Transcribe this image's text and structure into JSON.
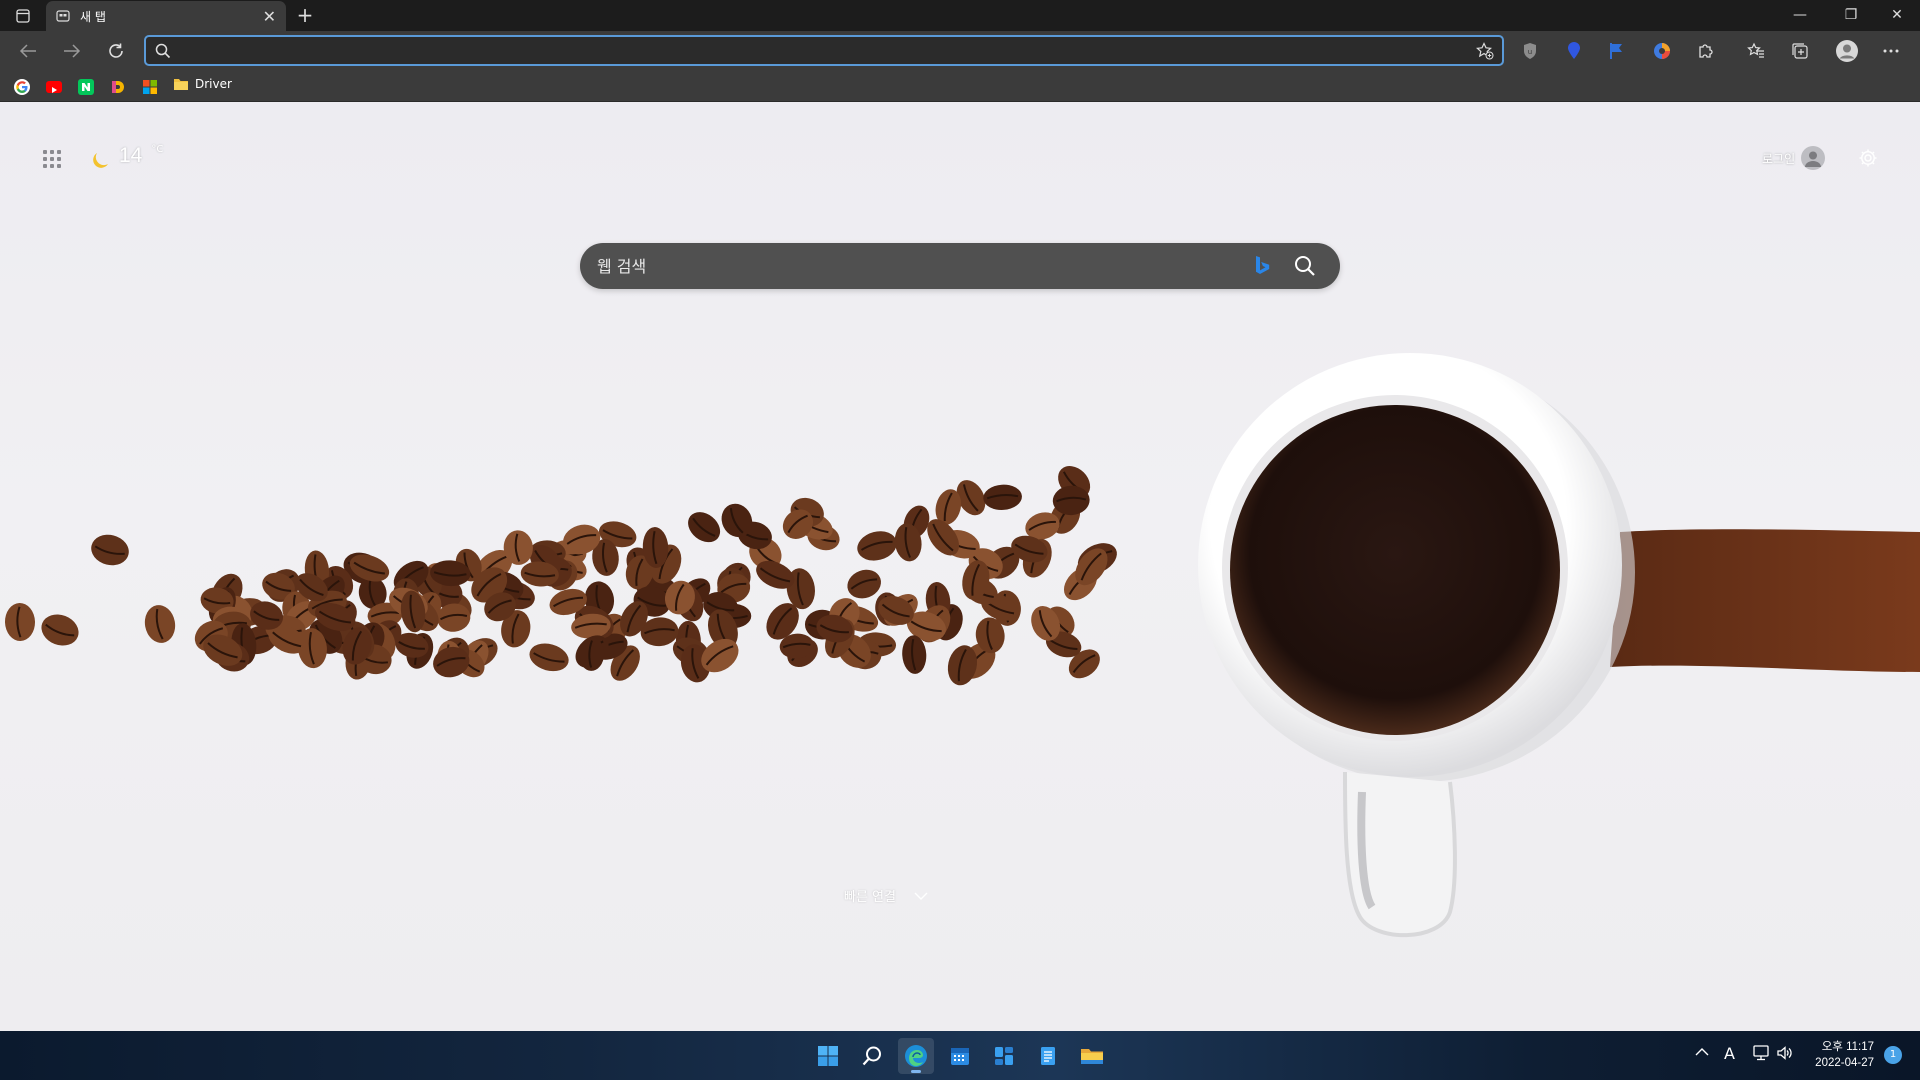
{
  "browser": {
    "tab": {
      "title": "새 탭"
    },
    "address_bar": {
      "value": "",
      "placeholder": ""
    },
    "bookmarks": [
      {
        "name": "Google",
        "icon": "google-icon",
        "color": "#ffffff"
      },
      {
        "name": "YouTube",
        "icon": "youtube-icon",
        "color": "#ff0000"
      },
      {
        "name": "Naver",
        "icon": "naver-icon",
        "color": "#03c75a"
      },
      {
        "name": "D",
        "icon": "d-icon",
        "color": "#f5b400"
      },
      {
        "name": "Microsoft",
        "icon": "microsoft-icon",
        "color": "#0078d4"
      }
    ],
    "bookmark_folder": {
      "label": "Driver"
    }
  },
  "ntp": {
    "weather": {
      "temperature": "14",
      "unit": "°C",
      "icon": "moon-icon"
    },
    "login_label": "로그인",
    "search": {
      "placeholder": "웹 검색"
    },
    "quick_links_label": "빠른 연결"
  },
  "taskbar": {
    "apps": [
      "start",
      "search",
      "edge",
      "calendar",
      "widgets",
      "notepad",
      "file-explorer"
    ],
    "tray": {
      "language": "A"
    },
    "clock": {
      "time": "오후 11:17",
      "date": "2022-04-27"
    },
    "notifications": "1"
  },
  "colors": {
    "accent": "#5a9ad8",
    "taskbar": "#13263f"
  }
}
